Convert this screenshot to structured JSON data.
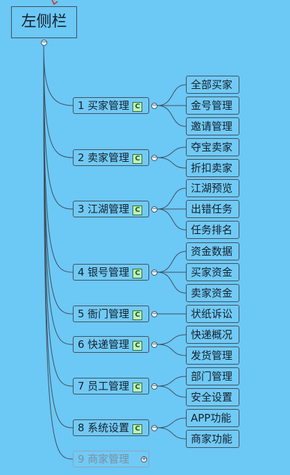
{
  "root": {
    "label": "左侧栏"
  },
  "badge": "C",
  "categories": [
    {
      "label": "1 买家管理",
      "badge": true,
      "children": [
        "全部买家",
        "金号管理",
        "邀请管理"
      ]
    },
    {
      "label": "2 卖家管理",
      "badge": true,
      "children": [
        "夺宝卖家",
        "折扣卖家"
      ]
    },
    {
      "label": "3 江湖管理",
      "badge": true,
      "children": [
        "江湖预览",
        "出错任务",
        "任务排名"
      ]
    },
    {
      "label": "4 银号管理",
      "badge": true,
      "children": [
        "资金数据",
        "买家资金",
        "卖家资金"
      ]
    },
    {
      "label": "5 衙门管理",
      "badge": true,
      "children": [
        "状纸诉讼"
      ]
    },
    {
      "label": "6 快递管理",
      "badge": true,
      "children": [
        "快递概况",
        "发货管理"
      ]
    },
    {
      "label": "7 员工管理",
      "badge": true,
      "children": [
        "部门管理",
        "安全设置"
      ]
    },
    {
      "label": "8 系统设置",
      "badge": true,
      "children": [
        "APP功能",
        "商家功能"
      ]
    },
    {
      "label": "9 商家管理",
      "badge": false,
      "collapsed": true,
      "children": []
    }
  ],
  "colors": {
    "background": "#6cc8f5",
    "line": "#3f4d5c",
    "badge_fill": "#bff0bf"
  }
}
